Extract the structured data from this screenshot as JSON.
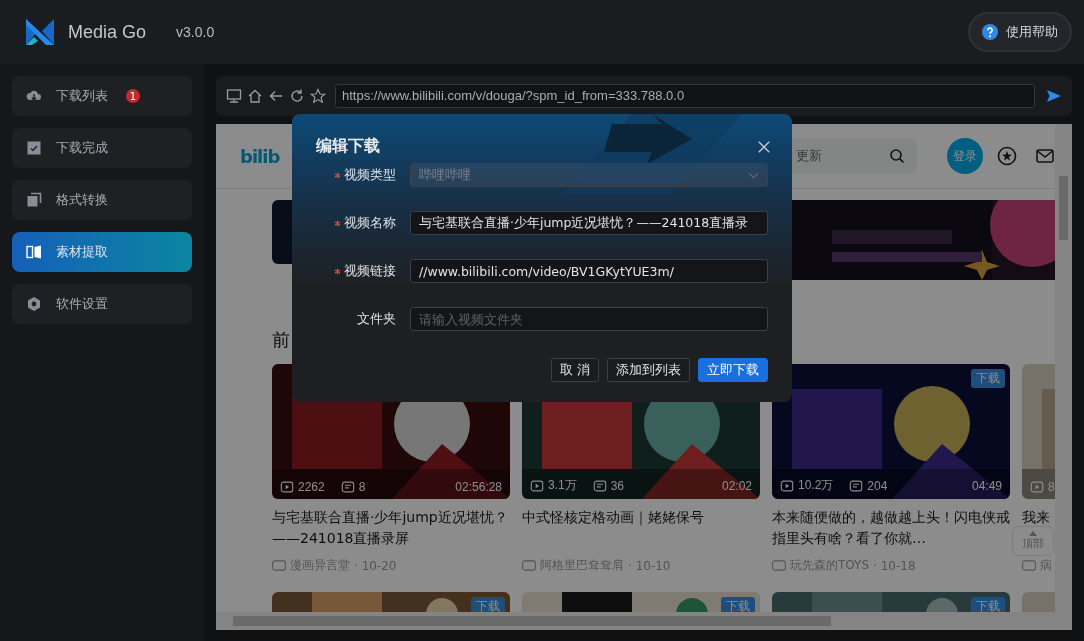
{
  "app": {
    "name": "Media Go",
    "version": "v3.0.0",
    "help_button": "使用帮助"
  },
  "sidebar": {
    "items": [
      {
        "label": "下载列表",
        "badge": "1",
        "selected": false
      },
      {
        "label": "下载完成",
        "selected": false
      },
      {
        "label": "格式转换",
        "selected": false
      },
      {
        "label": "素材提取",
        "selected": true
      },
      {
        "label": "软件设置",
        "selected": false
      }
    ]
  },
  "browser": {
    "url": "https://www.bilibili.com/v/douga/?spm_id_from=333.788.0.0"
  },
  "webpage": {
    "logo": "bilib",
    "search_placeholder": "更新",
    "login_button": "登录",
    "section_heading": "前",
    "back_to_top": "顶部",
    "videos": [
      {
        "views": "2262",
        "comments": "8",
        "duration": "02:56:28",
        "title": "与宅基联合直播·少年jump近况堪忧？——241018直播录屏",
        "uploader": "漫画异言堂",
        "date": "· 10-20"
      },
      {
        "views": "3.1万",
        "comments": "36",
        "duration": "02:02",
        "title": "中式怪核定格动画｜姥姥保号",
        "uploader": "阿格里巴耷耷肩",
        "date": "· 10-10"
      },
      {
        "views": "10.2万",
        "comments": "204",
        "duration": "04:49",
        "title": "本来随便做的，越做越上头！闪电侠戒指里头有啥？看了你就…",
        "uploader": "玩先森的TOYS",
        "date": "· 10-18",
        "badge": "下载"
      },
      {
        "views": "8",
        "title": "我来",
        "uploader": "病"
      }
    ],
    "second_row": [
      {
        "kind": "picture",
        "badge": "下载"
      },
      {
        "kind": "picture",
        "badge": "下载"
      },
      {
        "kind": "picture",
        "badge": "下载"
      },
      {
        "kind": "picture"
      }
    ]
  },
  "dialog": {
    "title": "编辑下载",
    "fields": [
      {
        "kind": "select",
        "label": "视频类型",
        "required": true,
        "value": "哔哩哔哩",
        "disabled": true
      },
      {
        "kind": "input",
        "label": "视频名称",
        "required": true,
        "value": "与宅基联合直播·少年jump近况堪忧？——241018直播录"
      },
      {
        "kind": "input",
        "label": "视频链接",
        "required": true,
        "value": "//www.bilibili.com/video/BV1GKytYUE3m/"
      },
      {
        "kind": "input",
        "label": "文件夹",
        "required": false,
        "placeholder": "请输入视频文件夹"
      }
    ],
    "buttons": [
      {
        "label": "取 消",
        "primary": false
      },
      {
        "label": "添加到列表",
        "primary": false
      },
      {
        "label": "立即下载",
        "primary": true
      }
    ]
  }
}
